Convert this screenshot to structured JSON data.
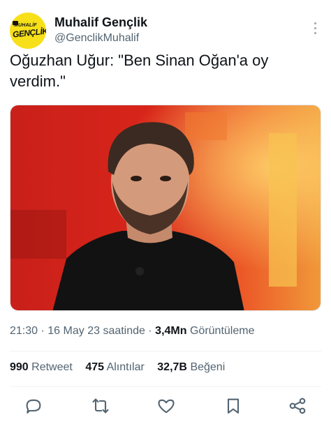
{
  "account": {
    "name": "Muhalif Gençlik",
    "handle": "@GenclikMuhalif",
    "avatar": {
      "logo_top": "MUHALİF",
      "logo_main": "GENÇLİK",
      "bg_color": "#f7e01a"
    }
  },
  "tweet": {
    "text": "Oğuzhan Uğur: \"Ben Sinan Oğan'a oy verdim.\""
  },
  "media": {
    "type": "photo",
    "colors": {
      "background": "#d8251a",
      "accent": "#f6a43a",
      "sweater": "#111111"
    }
  },
  "meta": {
    "time": "21:30",
    "dot": "·",
    "date": "16 May 23 saatinde",
    "views_count": "3,4Mn",
    "views_label": "Görüntüleme"
  },
  "stats": {
    "retweets_count": "990",
    "retweets_label": "Retweet",
    "quotes_count": "475",
    "quotes_label": "Alıntılar",
    "likes_count": "32,7B",
    "likes_label": "Beğeni"
  },
  "actions": [
    {
      "icon": "reply-icon"
    },
    {
      "icon": "retweet-icon"
    },
    {
      "icon": "like-icon"
    },
    {
      "icon": "bookmark-icon"
    },
    {
      "icon": "share-icon"
    }
  ],
  "colors": {
    "text": "#0f1419",
    "muted": "#536471",
    "divider": "#eff3f4",
    "icon": "#536471"
  }
}
